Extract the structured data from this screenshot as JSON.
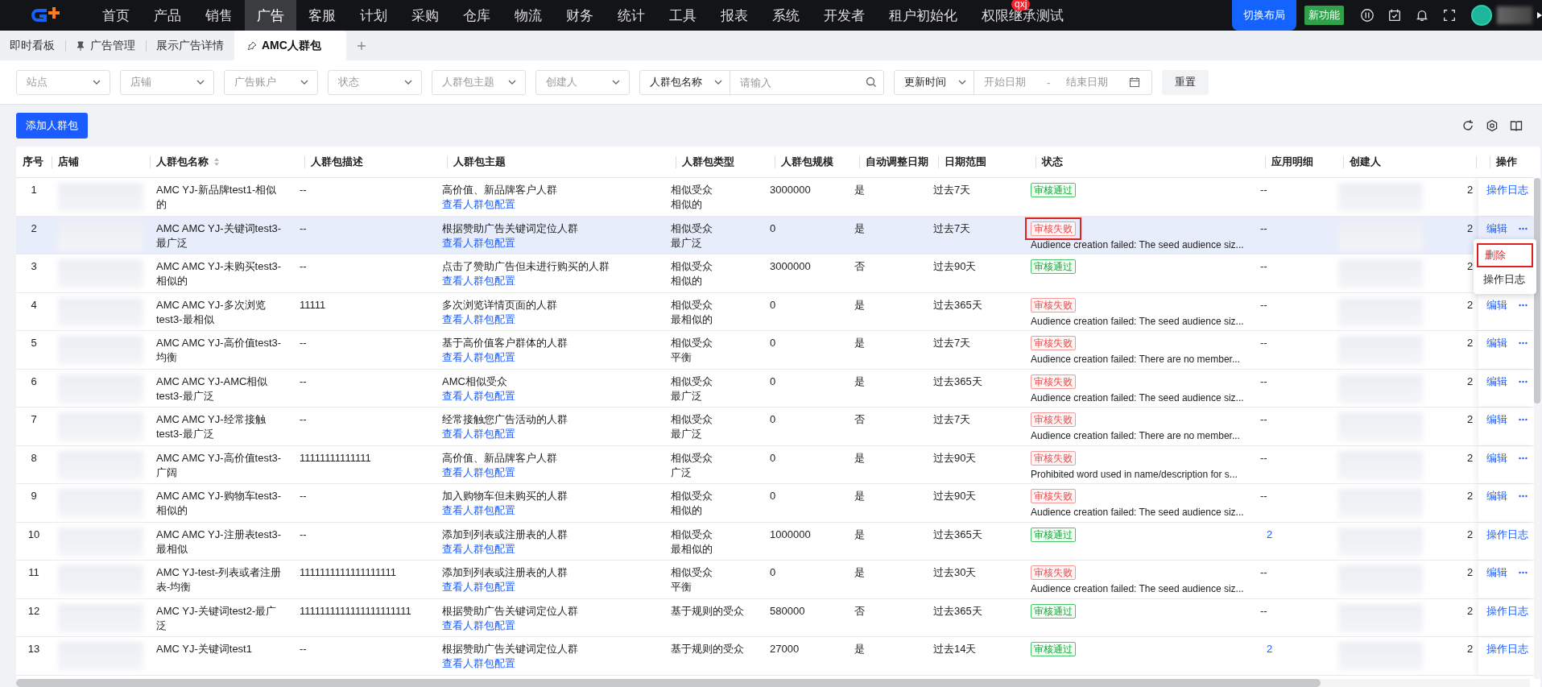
{
  "nav": {
    "items": [
      {
        "label": "首页",
        "selected": false
      },
      {
        "label": "产品",
        "selected": false
      },
      {
        "label": "销售",
        "selected": false
      },
      {
        "label": "广告",
        "selected": true
      },
      {
        "label": "客服",
        "selected": false
      },
      {
        "label": "计划",
        "selected": false
      },
      {
        "label": "采购",
        "selected": false
      },
      {
        "label": "仓库",
        "selected": false
      },
      {
        "label": "物流",
        "selected": false
      },
      {
        "label": "财务",
        "selected": false
      },
      {
        "label": "统计",
        "selected": false
      },
      {
        "label": "工具",
        "selected": false
      },
      {
        "label": "报表",
        "selected": false
      },
      {
        "label": "系统",
        "selected": false
      },
      {
        "label": "开发者",
        "selected": false
      },
      {
        "label": "租户初始化",
        "selected": false
      },
      {
        "label": "权限继承测试",
        "selected": false,
        "badge": "qxj"
      }
    ],
    "switch_layout": "切换布局",
    "new_feature": "新功能"
  },
  "tabs": [
    {
      "label": "即时看板",
      "selected": false,
      "pinned": false
    },
    {
      "label": "广告管理",
      "selected": false,
      "pinned": true
    },
    {
      "label": "展示广告详情",
      "selected": false,
      "pinned": false
    },
    {
      "label": "AMC人群包",
      "selected": true,
      "pinned": true
    }
  ],
  "filters": [
    {
      "placeholder": "站点"
    },
    {
      "placeholder": "店铺"
    },
    {
      "placeholder": "广告账户"
    },
    {
      "placeholder": "状态"
    },
    {
      "placeholder": "人群包主题"
    },
    {
      "placeholder": "创建人"
    }
  ],
  "name_filter": {
    "field": "人群包名称",
    "placeholder": "请输入"
  },
  "date_filter": {
    "field": "更新时间",
    "start_placeholder": "开始日期",
    "separator": "-",
    "end_placeholder": "结束日期"
  },
  "reset_button": "重置",
  "add_button": "添加人群包",
  "table": {
    "columns": [
      {
        "label": "序号",
        "sortable": false
      },
      {
        "label": "店铺",
        "sortable": false
      },
      {
        "label": "人群包名称",
        "sortable": true
      },
      {
        "label": "人群包描述",
        "sortable": false
      },
      {
        "label": "人群包主题",
        "sortable": false
      },
      {
        "label": "人群包类型",
        "sortable": false
      },
      {
        "label": "人群包规模",
        "sortable": false
      },
      {
        "label": "自动调整日期",
        "sortable": false
      },
      {
        "label": "日期范围",
        "sortable": false
      },
      {
        "label": "状态",
        "sortable": false
      },
      {
        "label": "应用明细",
        "sortable": false
      },
      {
        "label": "创建人",
        "sortable": false
      },
      {
        "sortable": false
      },
      {
        "label": "操作",
        "sortable": false
      }
    ],
    "rows": [
      {
        "selected": false,
        "index": "1",
        "name": "AMC YJ-新品牌test1-相似的",
        "description": "--",
        "theme": "高价值、新品牌客户人群",
        "theme_link": "查看人群包配置",
        "type": [
          "相似受众",
          "相似的"
        ],
        "size": "3000000",
        "auto_adjust": "是",
        "date_range": "过去7天",
        "status": {
          "kind": "pass",
          "label": "审核通过",
          "highlighted": false
        },
        "usage": {
          "text": "--",
          "link": false
        },
        "column_13": "2",
        "actions": [
          "操作日志"
        ]
      },
      {
        "selected": true,
        "index": "2",
        "name": "AMC AMC YJ-关键词test3-最广泛",
        "description": "--",
        "theme": "根据赞助广告关键词定位人群",
        "theme_link": "查看人群包配置",
        "type": [
          "相似受众",
          "最广泛"
        ],
        "size": "0",
        "auto_adjust": "是",
        "date_range": "过去7天",
        "status": {
          "kind": "fail",
          "label": "审核失败",
          "message": "Audience creation failed: The seed audience siz...",
          "highlighted": true
        },
        "usage": {
          "text": "--",
          "link": false
        },
        "column_13": "2",
        "actions": [
          "编辑"
        ],
        "more": true
      },
      {
        "selected": false,
        "index": "3",
        "name": "AMC AMC YJ-未购买test3-相似的",
        "description": "--",
        "theme": "点击了赞助广告但未进行购买的人群",
        "theme_link": "查看人群包配置",
        "type": [
          "相似受众",
          "相似的"
        ],
        "size": "3000000",
        "auto_adjust": "否",
        "date_range": "过去90天",
        "status": {
          "kind": "pass",
          "label": "审核通过",
          "highlighted": false
        },
        "usage": {
          "text": "--",
          "link": false
        },
        "column_13": "2"
      },
      {
        "selected": false,
        "index": "4",
        "name": "AMC AMC YJ-多次浏览test3-最相似",
        "description": "11111",
        "theme": "多次浏览详情页面的人群",
        "theme_link": "查看人群包配置",
        "type": [
          "相似受众",
          "最相似的"
        ],
        "size": "0",
        "auto_adjust": "是",
        "date_range": "过去365天",
        "status": {
          "kind": "fail",
          "label": "审核失败",
          "message": "Audience creation failed: The seed audience siz...",
          "highlighted": false
        },
        "usage": {
          "text": "--",
          "link": false
        },
        "column_13": "2",
        "actions": [
          "编辑"
        ],
        "more": true
      },
      {
        "selected": false,
        "index": "5",
        "name": "AMC AMC YJ-高价值test3-均衡",
        "description": "--",
        "theme": "基于高价值客户群体的人群",
        "theme_link": "查看人群包配置",
        "type": [
          "相似受众",
          "平衡"
        ],
        "size": "0",
        "auto_adjust": "是",
        "date_range": "过去7天",
        "status": {
          "kind": "fail",
          "label": "审核失败",
          "message": "Audience creation failed: There are no member...",
          "highlighted": false
        },
        "usage": {
          "text": "--",
          "link": false
        },
        "column_13": "2",
        "actions": [
          "编辑"
        ],
        "more": true
      },
      {
        "selected": false,
        "index": "6",
        "name": "AMC AMC YJ-AMC相似test3-最广泛",
        "description": "--",
        "theme": "AMC相似受众",
        "theme_link": "查看人群包配置",
        "type": [
          "相似受众",
          "最广泛"
        ],
        "size": "0",
        "auto_adjust": "是",
        "date_range": "过去365天",
        "status": {
          "kind": "fail",
          "label": "审核失败",
          "message": "Audience creation failed: The seed audience siz...",
          "highlighted": false
        },
        "usage": {
          "text": "--",
          "link": false
        },
        "column_13": "2",
        "actions": [
          "编辑"
        ],
        "more": true
      },
      {
        "selected": false,
        "index": "7",
        "name": "AMC AMC YJ-经常接触test3-最广泛",
        "description": "--",
        "theme": "经常接触您广告活动的人群",
        "theme_link": "查看人群包配置",
        "type": [
          "相似受众",
          "最广泛"
        ],
        "size": "0",
        "auto_adjust": "否",
        "date_range": "过去7天",
        "status": {
          "kind": "fail",
          "label": "审核失败",
          "message": "Audience creation failed: There are no member...",
          "highlighted": false
        },
        "usage": {
          "text": "--",
          "link": false
        },
        "column_13": "2",
        "actions": [
          "编辑"
        ],
        "more": true
      },
      {
        "selected": false,
        "index": "8",
        "name": "AMC AMC YJ-高价值test3-广阔",
        "description": "11111111111111",
        "theme": "高价值、新品牌客户人群",
        "theme_link": "查看人群包配置",
        "type": [
          "相似受众",
          "广泛"
        ],
        "size": "0",
        "auto_adjust": "是",
        "date_range": "过去90天",
        "status": {
          "kind": "fail",
          "label": "审核失败",
          "message": "Prohibited word used in name/description for s...",
          "highlighted": false
        },
        "usage": {
          "text": "--",
          "link": false
        },
        "column_13": "2",
        "actions": [
          "编辑"
        ],
        "more": true
      },
      {
        "selected": false,
        "index": "9",
        "name": "AMC AMC YJ-购物车test3-相似的",
        "description": "--",
        "theme": "加入购物车但未购买的人群",
        "theme_link": "查看人群包配置",
        "type": [
          "相似受众",
          "相似的"
        ],
        "size": "0",
        "auto_adjust": "是",
        "date_range": "过去90天",
        "status": {
          "kind": "fail",
          "label": "审核失败",
          "message": "Audience creation failed: The seed audience siz...",
          "highlighted": false
        },
        "usage": {
          "text": "--",
          "link": false
        },
        "column_13": "2",
        "actions": [
          "编辑"
        ],
        "more": true
      },
      {
        "selected": false,
        "index": "10",
        "name": "AMC AMC YJ-注册表test3-最相似",
        "description": "--",
        "theme": "添加到列表或注册表的人群",
        "theme_link": "查看人群包配置",
        "type": [
          "相似受众",
          "最相似的"
        ],
        "size": "1000000",
        "auto_adjust": "是",
        "date_range": "过去365天",
        "status": {
          "kind": "pass",
          "label": "审核通过",
          "highlighted": false
        },
        "usage": {
          "text": "2",
          "link": true
        },
        "column_13": "2",
        "actions": [
          "操作日志"
        ]
      },
      {
        "selected": false,
        "index": "11",
        "name": "AMC YJ-test-列表或者注册表-均衡",
        "description": "1111111111111111111",
        "theme": "添加到列表或注册表的人群",
        "theme_link": "查看人群包配置",
        "type": [
          "相似受众",
          "平衡"
        ],
        "size": "0",
        "auto_adjust": "是",
        "date_range": "过去30天",
        "status": {
          "kind": "fail",
          "label": "审核失败",
          "message": "Audience creation failed: The seed audience siz...",
          "highlighted": false
        },
        "usage": {
          "text": "--",
          "link": false
        },
        "column_13": "2",
        "actions": [
          "编辑"
        ],
        "more": true
      },
      {
        "selected": false,
        "index": "12",
        "name": "AMC YJ-关键词test2-最广泛",
        "description": "1111111111111111111111",
        "theme": "根据赞助广告关键词定位人群",
        "theme_link": "查看人群包配置",
        "type": [
          "基于规则的受众"
        ],
        "size": "580000",
        "auto_adjust": "否",
        "date_range": "过去365天",
        "status": {
          "kind": "pass",
          "label": "审核通过",
          "highlighted": false
        },
        "usage": {
          "text": "--",
          "link": false
        },
        "column_13": "2",
        "actions": [
          "操作日志"
        ]
      },
      {
        "selected": false,
        "index": "13",
        "name": "AMC YJ-关键词test1",
        "description": "--",
        "theme": "根据赞助广告关键词定位人群",
        "theme_link": "查看人群包配置",
        "type": [
          "基于规则的受众"
        ],
        "size": "27000",
        "auto_adjust": "是",
        "date_range": "过去14天",
        "status": {
          "kind": "pass",
          "label": "审核通过",
          "highlighted": false
        },
        "usage": {
          "text": "2",
          "link": true
        },
        "column_13": "2",
        "actions": [
          "操作日志"
        ]
      }
    ]
  },
  "row_menu": {
    "items": [
      {
        "label": "删除",
        "kind": "danger",
        "highlighted": true
      },
      {
        "label": "操作日志",
        "kind": "normal",
        "highlighted": false
      }
    ]
  }
}
